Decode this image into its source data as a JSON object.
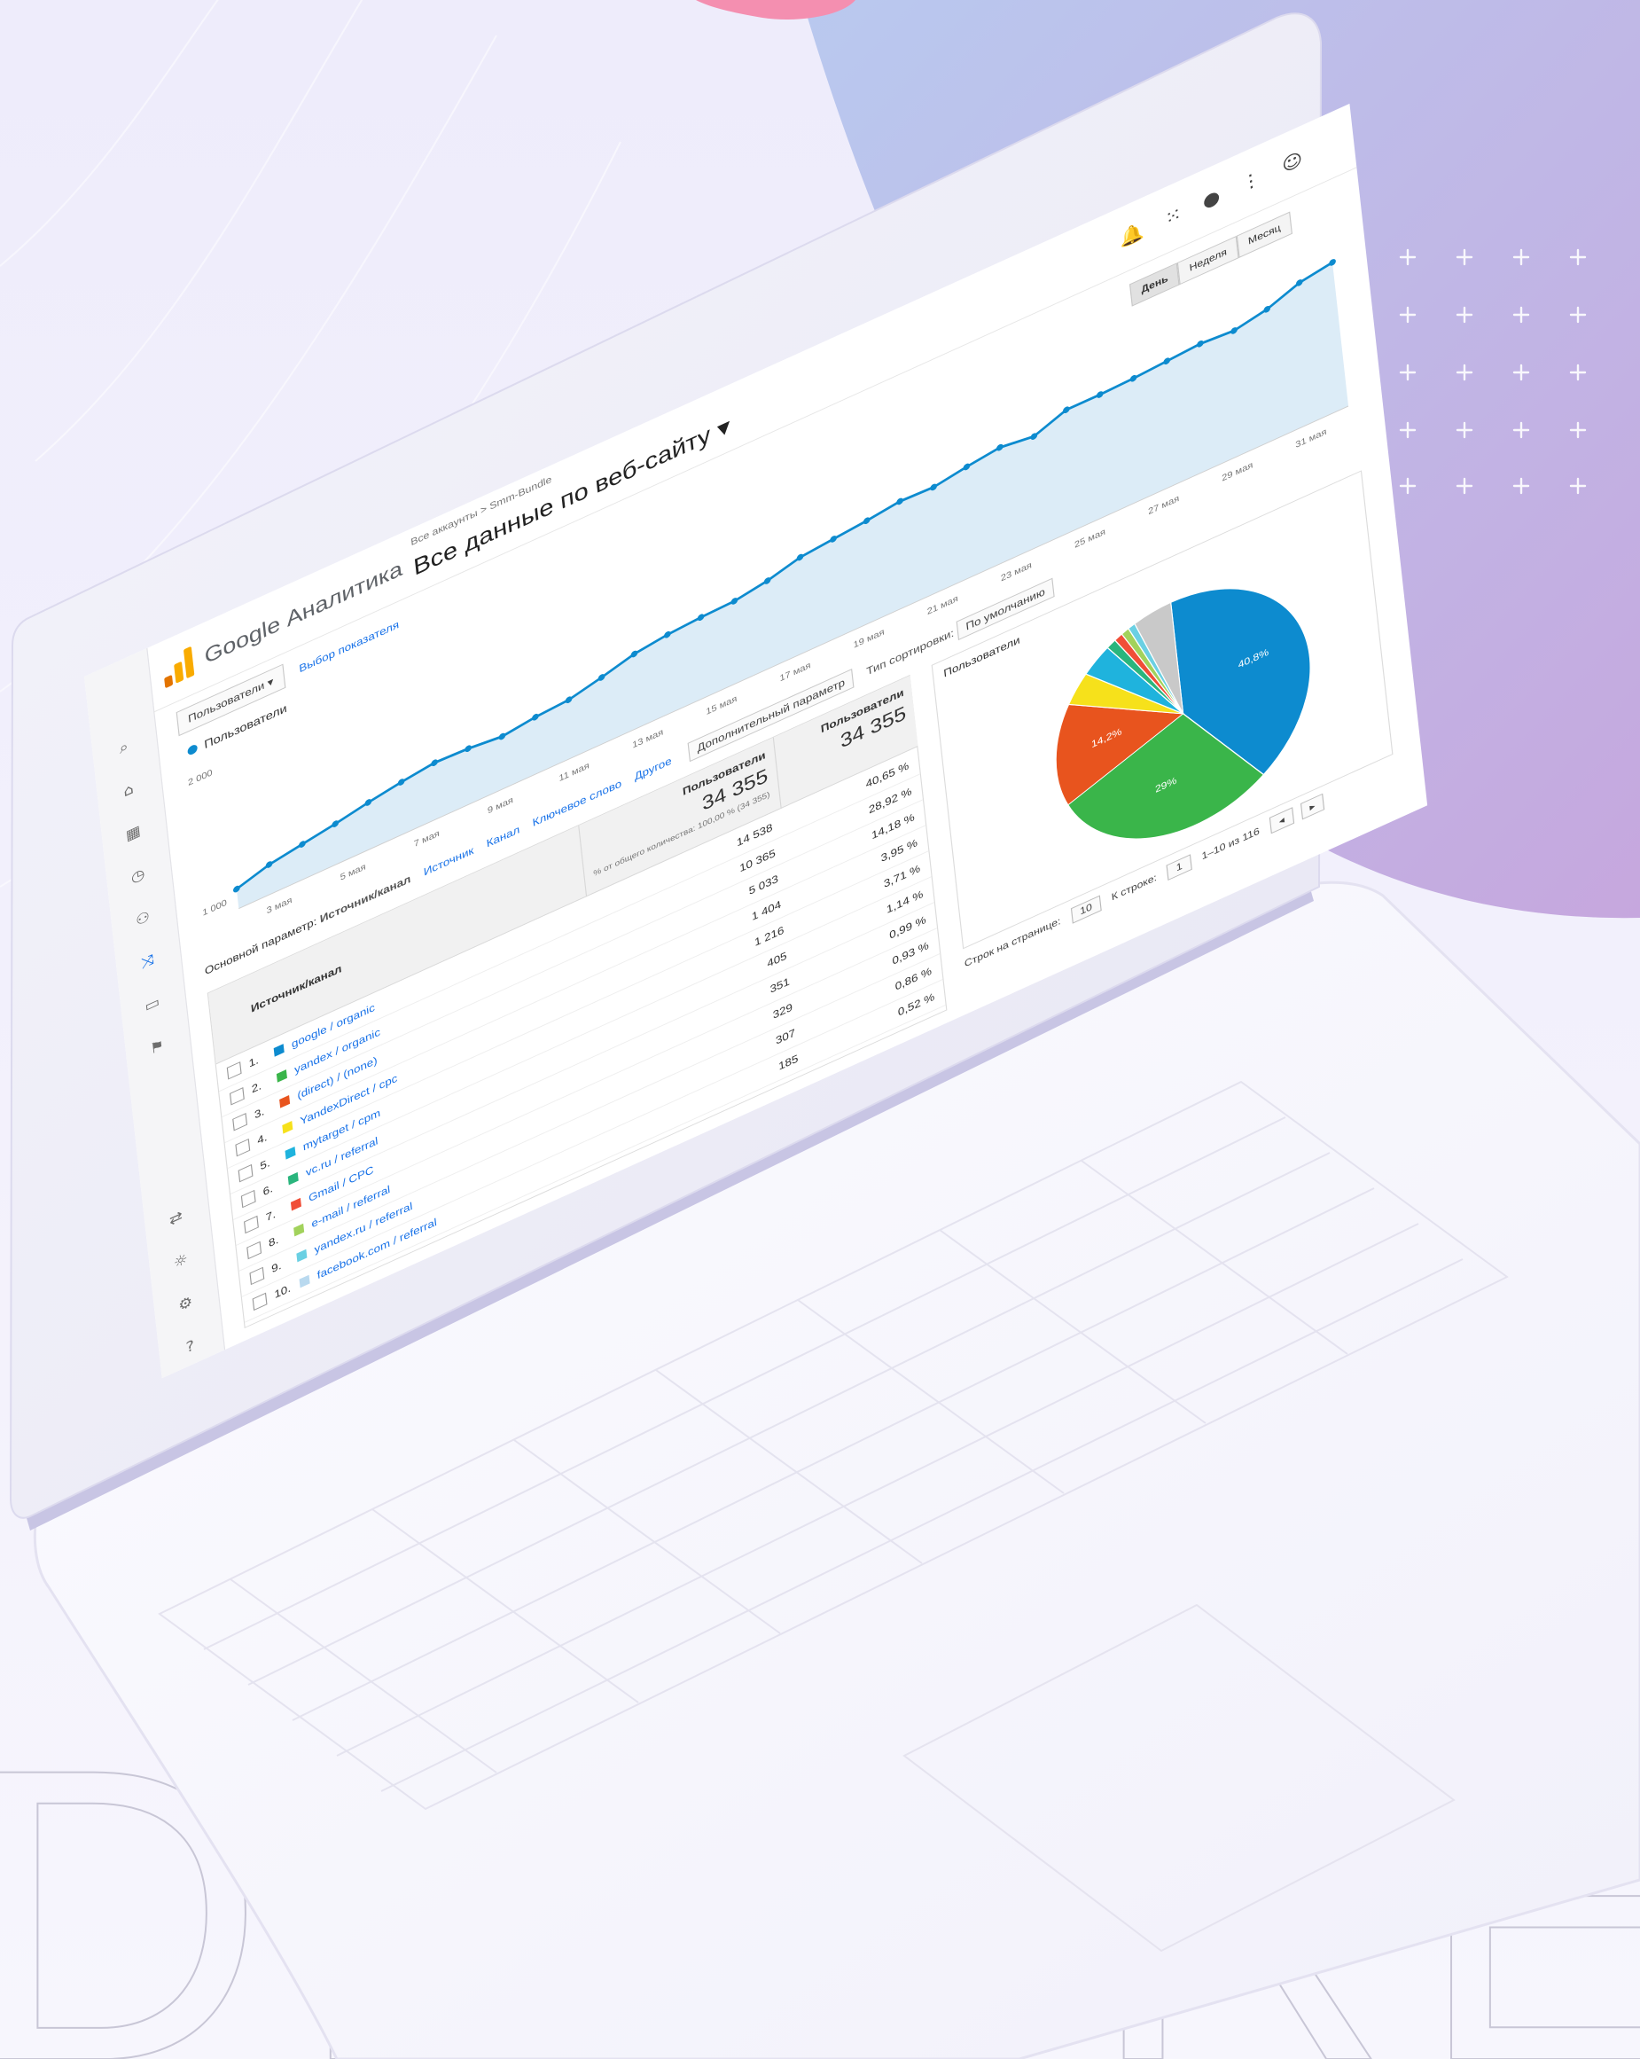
{
  "colors": {
    "accent_blue": "#0d8bcf",
    "area_fill": "#dcecf7",
    "bg_blob_blue": "#b8c7ee",
    "bg_blob_purple": "#c4a9e0",
    "pink_blob": "#f48fb0"
  },
  "app": {
    "title": "Google Аналитика"
  },
  "header": {
    "breadcrumb": "Все аккаунты > Smm-Bundle",
    "page_title": "Все данные по веб-сайту ▾",
    "icons": [
      "notification-icon",
      "apps-icon",
      "help-icon",
      "more-icon",
      "account-icon"
    ]
  },
  "toolbar": {
    "metric_select": "Пользователи ▾",
    "compare_link": "Выбор показателя",
    "range_buttons": [
      "День",
      "Неделя",
      "Месяц"
    ]
  },
  "chart": {
    "legend": "Пользователи",
    "ytick_top": "2 000",
    "ytick_bottom": "1 000"
  },
  "chart_data": {
    "type": "area",
    "series": [
      {
        "name": "Пользователи",
        "values": [
          990,
          1080,
          1130,
          1180,
          1240,
          1290,
          1330,
          1320,
          1290,
          1330,
          1350,
          1420,
          1500,
          1540,
          1560,
          1570,
          1620,
          1700,
          1730,
          1760,
          1800,
          1790,
          1840,
          1880,
          1840,
          1950,
          1950,
          1960,
          1980,
          2000,
          1980,
          2040,
          2150,
          2200
        ]
      }
    ],
    "x_tick_labels": [
      "3 мая",
      "5 мая",
      "7 мая",
      "9 мая",
      "11 мая",
      "13 мая",
      "15 мая",
      "17 мая",
      "19 мая",
      "21 мая",
      "23 мая",
      "25 мая",
      "27 мая",
      "29 мая",
      "31 мая"
    ],
    "ylim": [
      800,
      2300
    ],
    "grid": false
  },
  "segments": {
    "primary_label": "Основной параметр:",
    "primary_value": "Источник/канал",
    "links": [
      "Источник",
      "Канал",
      "Ключевое слово",
      "Другое"
    ],
    "secondary": "Дополнительный параметр",
    "sort": "Тип сортировки:",
    "sort_value": "По умолчанию"
  },
  "table": {
    "header_dimension": "Источник/канал",
    "header_users": "Пользователи",
    "header_share": "Пользователи",
    "total_users": "34 355",
    "total_share": "34 355",
    "total_note": "% от общего количества: 100,00 % (34 355)",
    "rows": [
      {
        "idx": "1.",
        "source": "google / organic",
        "swatch": "#0d8bcf",
        "users": "14 538",
        "share": "40,65 %"
      },
      {
        "idx": "2.",
        "source": "yandex / organic",
        "swatch": "#3ab54a",
        "users": "10 365",
        "share": "28,92 %"
      },
      {
        "idx": "3.",
        "source": "(direct) / (none)",
        "swatch": "#e8541e",
        "users": "5 033",
        "share": "14,18 %"
      },
      {
        "idx": "4.",
        "source": "YandexDirect / cpc",
        "swatch": "#f6e11b",
        "users": "1 404",
        "share": "3,95 %"
      },
      {
        "idx": "5.",
        "source": "mytarget / cpm",
        "swatch": "#1fb3dd",
        "users": "1 216",
        "share": "3,71 %"
      },
      {
        "idx": "6.",
        "source": "vc.ru / referral",
        "swatch": "#2ab57d",
        "users": "405",
        "share": "1,14 %"
      },
      {
        "idx": "7.",
        "source": "Gmail / CPC",
        "swatch": "#f04e37",
        "users": "351",
        "share": "0,99 %"
      },
      {
        "idx": "8.",
        "source": "e-mail / referral",
        "swatch": "#a2d25c",
        "users": "329",
        "share": "0,93 %"
      },
      {
        "idx": "9.",
        "source": "yandex.ru / referral",
        "swatch": "#6ad0e3",
        "users": "307",
        "share": "0,86 %"
      },
      {
        "idx": "10.",
        "source": "facebook.com / referral",
        "swatch": "#b9d9ef",
        "users": "185",
        "share": "0,52 %"
      }
    ]
  },
  "pie": {
    "header": "Пользователи",
    "slices": [
      {
        "label": "40,8%",
        "value": 40.65,
        "color": "#0d8bcf"
      },
      {
        "label": "29%",
        "value": 28.92,
        "color": "#3ab54a"
      },
      {
        "label": "14,2%",
        "value": 14.18,
        "color": "#e8541e"
      },
      {
        "label": "",
        "value": 3.95,
        "color": "#f6e11b"
      },
      {
        "label": "",
        "value": 3.71,
        "color": "#1fb3dd"
      },
      {
        "label": "",
        "value": 1.14,
        "color": "#2ab57d"
      },
      {
        "label": "",
        "value": 0.99,
        "color": "#f04e37"
      },
      {
        "label": "",
        "value": 0.93,
        "color": "#a2d25c"
      },
      {
        "label": "",
        "value": 0.86,
        "color": "#6ad0e3"
      },
      {
        "label": "",
        "value": 4.67,
        "color": "#c9c9c9"
      }
    ]
  },
  "pager": {
    "rows_label": "Строк на странице:",
    "rows_value": "10",
    "goto_label": "К строке:",
    "goto_value": "1",
    "range": "1–10 из 116"
  },
  "watermark": {
    "text": "DIKORE"
  }
}
